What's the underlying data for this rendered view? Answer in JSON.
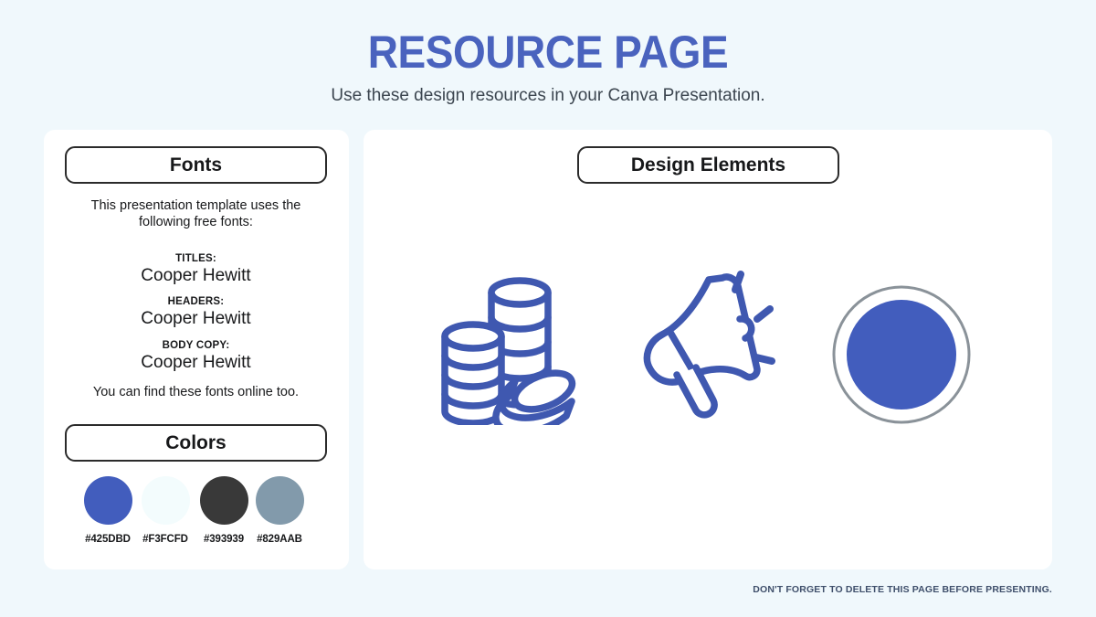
{
  "header": {
    "title": "RESOURCE PAGE",
    "subtitle": "Use these design resources in your Canva Presentation.",
    "title_color": "#4A63BE"
  },
  "fonts_panel": {
    "heading": "Fonts",
    "intro": "This presentation template uses the following free fonts:",
    "groups": [
      {
        "label": "TITLES:",
        "font": "Cooper Hewitt"
      },
      {
        "label": "HEADERS:",
        "font": "Cooper Hewitt"
      },
      {
        "label": "BODY COPY:",
        "font": "Cooper Hewitt"
      }
    ],
    "outro": "You can find these fonts online too."
  },
  "colors_panel": {
    "heading": "Colors",
    "swatches": [
      {
        "hex": "#425DBD"
      },
      {
        "hex": "#F3FCFD"
      },
      {
        "hex": "#393939"
      },
      {
        "hex": "#829AAB"
      }
    ]
  },
  "design_panel": {
    "heading": "Design Elements",
    "elements": [
      {
        "name": "coins-illustration",
        "stroke": "#3F58B0"
      },
      {
        "name": "megaphone-illustration",
        "stroke": "#3F58B0"
      },
      {
        "name": "circle-badge",
        "fill": "#425DBD",
        "ring": "#8A9299"
      }
    ]
  },
  "footer": {
    "note": "DON'T FORGET TO DELETE THIS PAGE BEFORE PRESENTING."
  },
  "page": {
    "background": "#F0F8FC",
    "card_background": "#FFFFFF"
  }
}
